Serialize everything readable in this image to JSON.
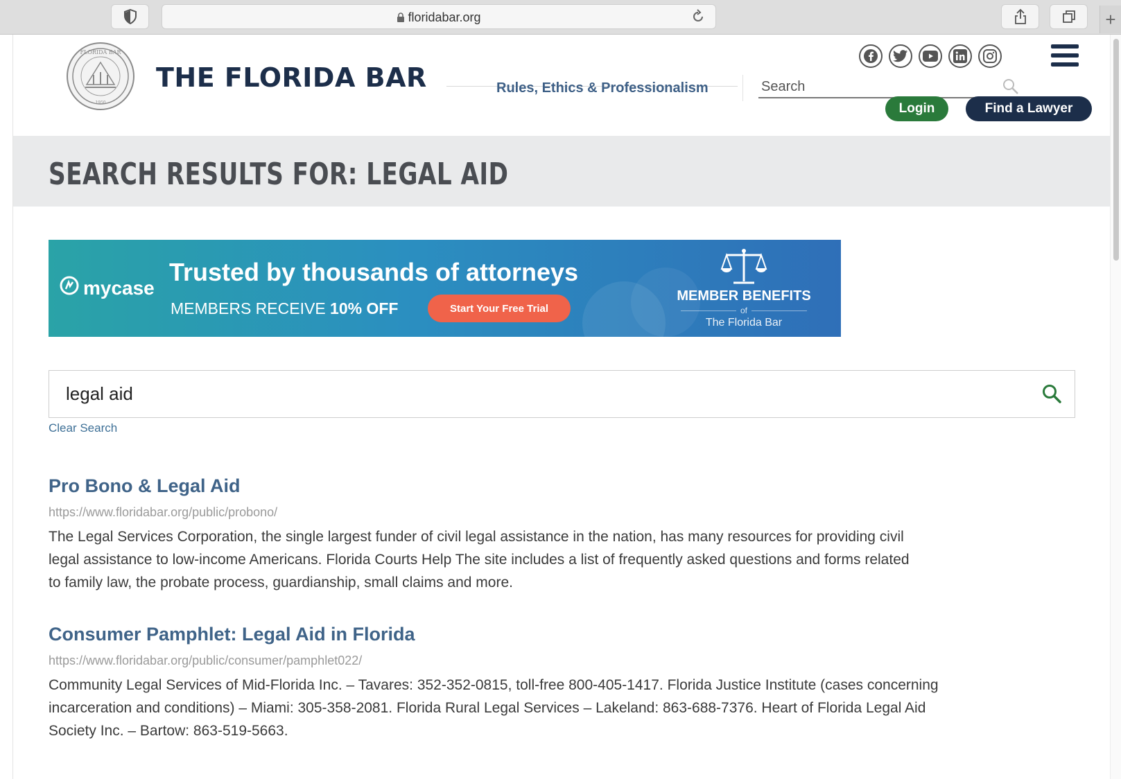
{
  "browser": {
    "url": "floridabar.org"
  },
  "header": {
    "brand": "THE FLORIDA BAR",
    "nav_link": "Rules, Ethics & Professionalism",
    "search_placeholder": "Search",
    "login_label": "Login",
    "find_lawyer_label": "Find a Lawyer",
    "social": [
      "facebook-icon",
      "twitter-icon",
      "youtube-icon",
      "linkedin-icon",
      "instagram-icon"
    ]
  },
  "page": {
    "title": "SEARCH RESULTS FOR: LEGAL AID"
  },
  "ad": {
    "logo": "mycase",
    "headline": "Trusted by thousands of attorneys",
    "sub_prefix": "MEMBERS RECEIVE ",
    "sub_bold": "10% OFF",
    "cta": "Start Your Free Trial",
    "benefits_title": "MEMBER BENEFITS",
    "benefits_of": "of",
    "benefits_sub": "The Florida Bar",
    "colors": {
      "start": "#2aa3a7",
      "end": "#2f6fb8",
      "cta": "#f0634a"
    }
  },
  "search": {
    "value": "legal aid",
    "clear_label": "Clear Search"
  },
  "results": [
    {
      "title": "Pro Bono & Legal Aid",
      "url": "https://www.floridabar.org/public/probono/",
      "desc_lines": [
        "The Legal Services Corporation, the single largest funder of civil legal assistance in the nation, has many resources for providing civil",
        "legal assistance to low-income Americans. Florida Courts Help The site includes a list of frequently asked questions and forms related",
        "to family law, the probate process, guardianship, small claims and more."
      ]
    },
    {
      "title": "Consumer Pamphlet: Legal Aid in Florida",
      "url": "https://www.floridabar.org/public/consumer/pamphlet022/",
      "desc_lines": [
        "Community Legal Services of Mid-Florida Inc. – Tavares: 352-352-0815, toll-free 800-405-1417. Florida Justice Institute (cases concerning",
        "incarceration and conditions) – Miami: 305-358-2081. Florida Rural Legal Services – Lakeland: 863-688-7376. Heart of Florida Legal Aid",
        "Society Inc. – Bartow: 863-519-5663."
      ]
    }
  ],
  "colors": {
    "brand_navy": "#1c2e4a",
    "login_green": "#2a7a3b",
    "link_blue": "#3f6388"
  }
}
